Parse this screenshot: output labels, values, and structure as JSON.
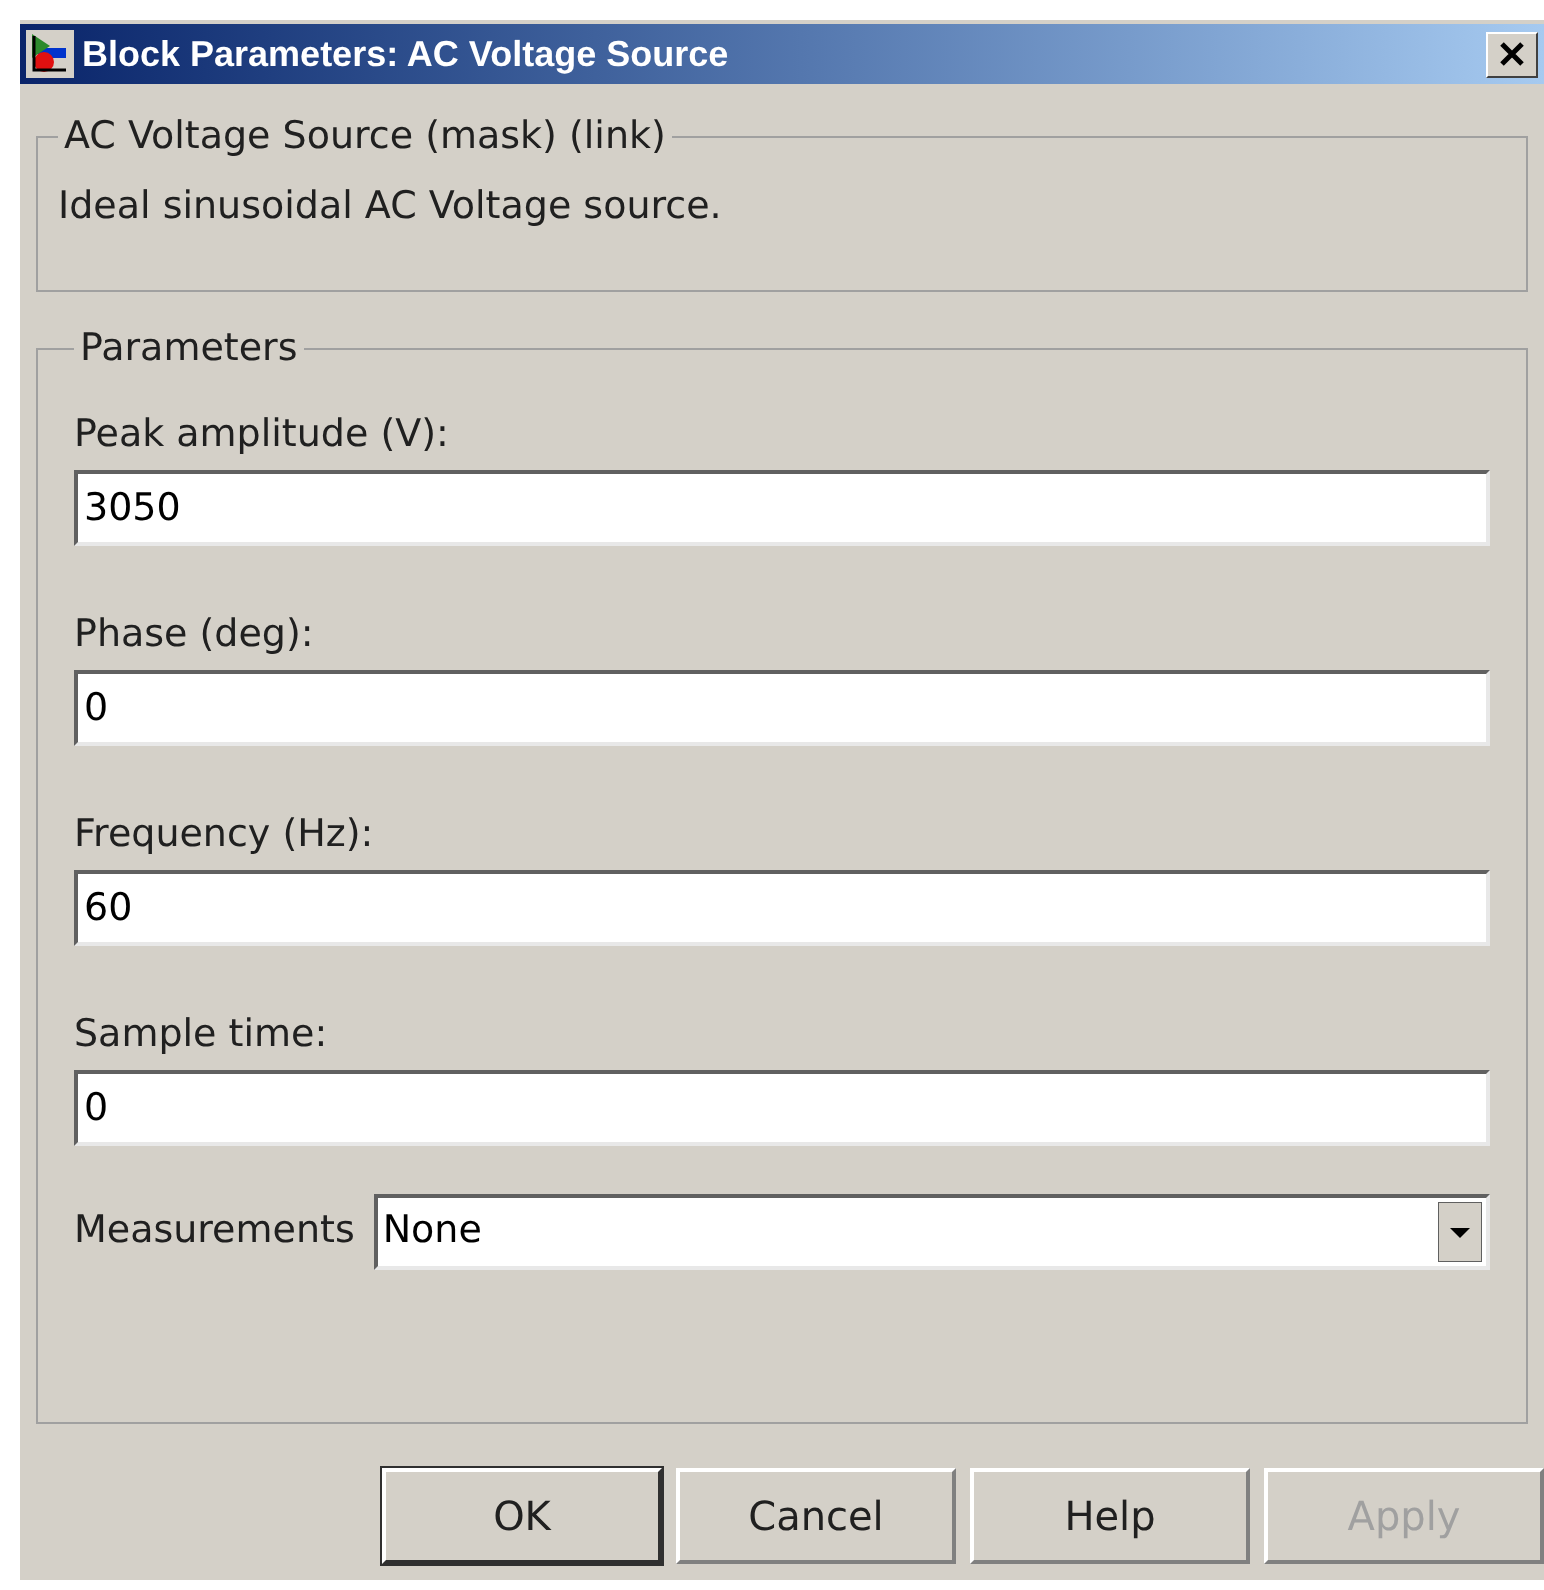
{
  "window": {
    "title": "Block Parameters: AC Voltage Source"
  },
  "description_group": {
    "title": "AC Voltage Source (mask) (link)",
    "text": "Ideal sinusoidal AC Voltage source."
  },
  "parameters_group": {
    "title": "Parameters",
    "fields": [
      {
        "label": "Peak amplitude (V):",
        "value": "3050"
      },
      {
        "label": "Phase (deg):",
        "value": "0"
      },
      {
        "label": "Frequency (Hz):",
        "value": "60"
      },
      {
        "label": "Sample time:",
        "value": "0"
      }
    ],
    "measurements": {
      "label": "Measurements",
      "value": "None"
    }
  },
  "buttons": [
    {
      "label": "OK",
      "disabled": false,
      "default": true
    },
    {
      "label": "Cancel",
      "disabled": false,
      "default": false
    },
    {
      "label": "Help",
      "disabled": false,
      "default": false
    },
    {
      "label": "Apply",
      "disabled": true,
      "default": false
    }
  ]
}
